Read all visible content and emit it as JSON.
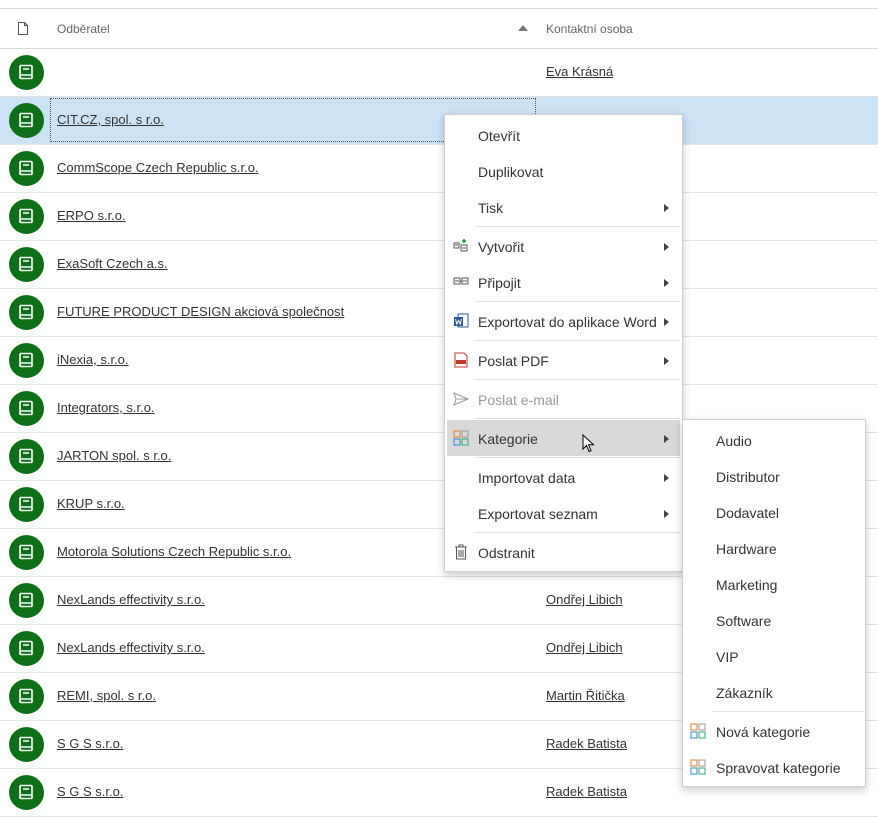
{
  "columns": {
    "name": "Odběratel",
    "contact": "Kontaktní osoba"
  },
  "rows": [
    {
      "name": "",
      "contact": "Eva Krásná"
    },
    {
      "name": "CIT.CZ, spol. s r.o.",
      "contact": ""
    },
    {
      "name": "CommScope Czech Republic s.r.o.",
      "contact": ""
    },
    {
      "name": "ERPO s.r.o.",
      "contact": ""
    },
    {
      "name": "ExaSoft Czech a.s.",
      "contact": ""
    },
    {
      "name": "FUTURE PRODUCT DESIGN akciová společnost",
      "contact": ""
    },
    {
      "name": "iNexia, s.r.o.",
      "contact": ""
    },
    {
      "name": "Integrators, s.r.o.",
      "contact": ""
    },
    {
      "name": "JARTON spol. s r.o.",
      "contact": ""
    },
    {
      "name": "KRUP s.r.o.",
      "contact": ""
    },
    {
      "name": "Motorola Solutions Czech Republic s.r.o.",
      "contact": ""
    },
    {
      "name": "NexLands effectivity s.r.o.",
      "contact": "Ondřej Libich"
    },
    {
      "name": "NexLands effectivity s.r.o.",
      "contact": "Ondřej Libich"
    },
    {
      "name": "REMI, spol. s r.o.",
      "contact": "Martin Řitička"
    },
    {
      "name": "S G S s.r.o.",
      "contact": "Radek Batista"
    },
    {
      "name": "S G S s.r.o.",
      "contact": "Radek Batista"
    }
  ],
  "selected_row": 1,
  "context_menu": {
    "open": "Otevřít",
    "duplicate": "Duplikovat",
    "print": "Tisk",
    "create": "Vytvořit",
    "attach": "Připojit",
    "export_word": "Exportovat do aplikace Word",
    "send_pdf": "Poslat PDF",
    "send_email": "Poslat e-mail",
    "category": "Kategorie",
    "import_data": "Importovat data",
    "export_list": "Exportovat seznam",
    "delete": "Odstranit"
  },
  "category_submenu": {
    "items": [
      "Audio",
      "Distributor",
      "Dodavatel",
      "Hardware",
      "Marketing",
      "Software",
      "VIP",
      "Zákazník"
    ],
    "new_category": "Nová kategorie",
    "manage_categories": "Spravovat kategorie"
  },
  "colors": {
    "avatar": "#0f6e18",
    "selected_row": "#cce3f6",
    "menu_hover": "#d9d9d9"
  },
  "icons": {
    "row_avatar": "book-icon",
    "header": "document-icon",
    "sort": "sort-ascending-icon"
  }
}
